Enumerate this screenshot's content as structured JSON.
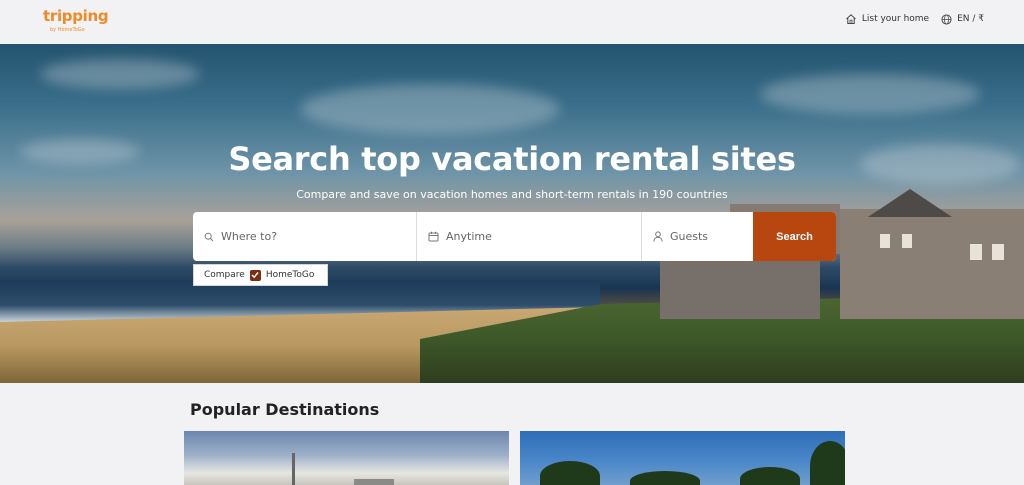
{
  "header": {
    "logo_text": "tripping",
    "logo_sub": "by HomeToGo",
    "list_home_label": "List your home",
    "locale_label": "EN / ₹",
    "icons": {
      "list_home": "house-icon",
      "locale": "globe-icon"
    },
    "accent_color": "#f08a24"
  },
  "hero": {
    "title": "Search top vacation rental sites",
    "subtitle": "Compare and save on vacation homes and short-term rentals in 190 countries"
  },
  "search": {
    "where_placeholder": "Where to?",
    "date_placeholder": "Anytime",
    "guests_placeholder": "Guests",
    "button_label": "Search",
    "button_color": "#b8470f",
    "icons": {
      "where": "search-icon",
      "date": "calendar-icon",
      "guests": "person-icon"
    }
  },
  "compare": {
    "label": "Compare",
    "provider": "HomeToGo",
    "checked": true
  },
  "popular": {
    "title": "Popular Destinations"
  }
}
